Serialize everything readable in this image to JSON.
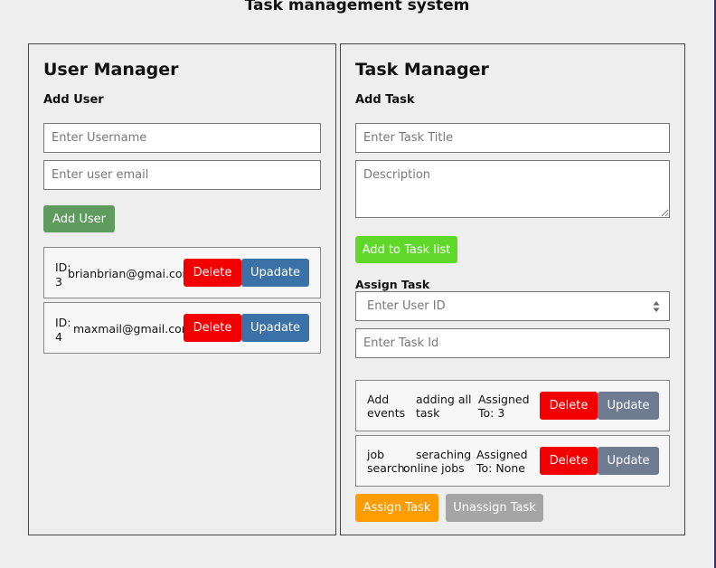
{
  "page": {
    "title": "Task management system"
  },
  "user_manager": {
    "title": "User Manager",
    "subtitle": "Add User",
    "username_placeholder": "Enter Username",
    "email_placeholder": "Enter user email",
    "add_button": "Add User",
    "users": [
      {
        "id_label": "ID:",
        "id": "3",
        "email": "brianbrian@gmai.com",
        "delete": "Delete",
        "update": "Upadate"
      },
      {
        "id_label": "ID:",
        "id": "4",
        "email": "maxmail@gmail.com",
        "delete": "Delete",
        "update": "Upadate"
      }
    ]
  },
  "task_manager": {
    "title": "Task Manager",
    "subtitle": "Add Task",
    "title_placeholder": "Enter Task Title",
    "description_placeholder": "Description",
    "add_button": "Add to Task list",
    "assign_label": "Assign Task",
    "user_id_placeholder": "Enter User ID",
    "task_id_placeholder": "Enter Task Id",
    "tasks": [
      {
        "title_line1": "Add",
        "title_line2": "events",
        "desc_line1": "adding all",
        "desc_line2": "task",
        "assigned_line1": "Assigned",
        "assigned_line2": "To: 3",
        "delete": "Delete",
        "update": "Update"
      },
      {
        "title_line1": "job",
        "title_line2": "search",
        "desc_line1": "seraching",
        "desc_line2": "online jobs",
        "assigned_line1": "Assigned",
        "assigned_line2": "To: None",
        "delete": "Delete",
        "update": "Update"
      }
    ],
    "assign_button": "Assign Task",
    "unassign_button": "Unassign Task"
  },
  "colors": {
    "background": "#eeeeee",
    "delete": "#f20000",
    "update_user": "#3a72a8",
    "update_task": "#6e7b91",
    "add_user": "#5f9a5f",
    "add_task": "#5fd82a",
    "assign": "#ff9c00",
    "unassign": "#a5a5a5"
  },
  "icons": {
    "select": "updown-arrows-icon"
  }
}
